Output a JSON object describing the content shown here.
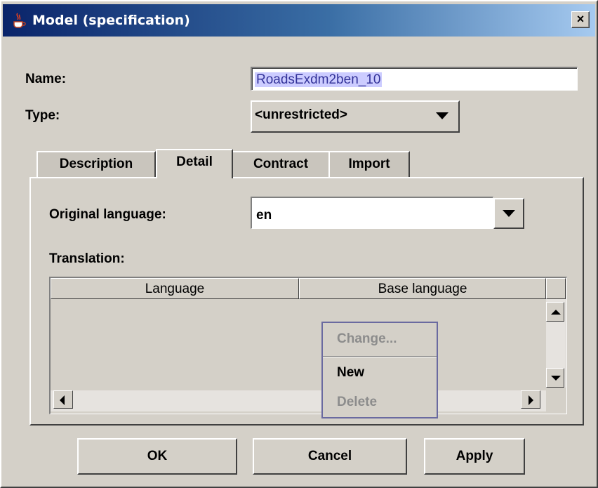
{
  "window": {
    "title": "Model (specification)",
    "close_glyph": "×",
    "title_icon": "java-cup-icon"
  },
  "form": {
    "name_label": "Name:",
    "name_value": "RoadsExdm2ben_10",
    "type_label": "Type:",
    "type_value": "<unrestricted>"
  },
  "tabs": [
    {
      "label": "Description",
      "active": false
    },
    {
      "label": "Detail",
      "active": true
    },
    {
      "label": "Contract",
      "active": false
    },
    {
      "label": "Import",
      "active": false
    }
  ],
  "detail": {
    "original_language_label": "Original language:",
    "original_language_value": "en",
    "translation_label": "Translation:",
    "columns": [
      "Language",
      "Base language"
    ]
  },
  "context_menu": {
    "items": [
      {
        "label": "Change...",
        "enabled": false
      },
      {
        "label": "New",
        "enabled": true
      },
      {
        "label": "Delete",
        "enabled": false
      }
    ]
  },
  "buttons": {
    "ok": "OK",
    "cancel": "Cancel",
    "apply": "Apply"
  },
  "colors": {
    "face": "#d4d0c8",
    "title_start": "#0a246a",
    "title_end": "#a6caf0",
    "selection": "#ccccff",
    "disabled_text": "#8c8c8c"
  }
}
